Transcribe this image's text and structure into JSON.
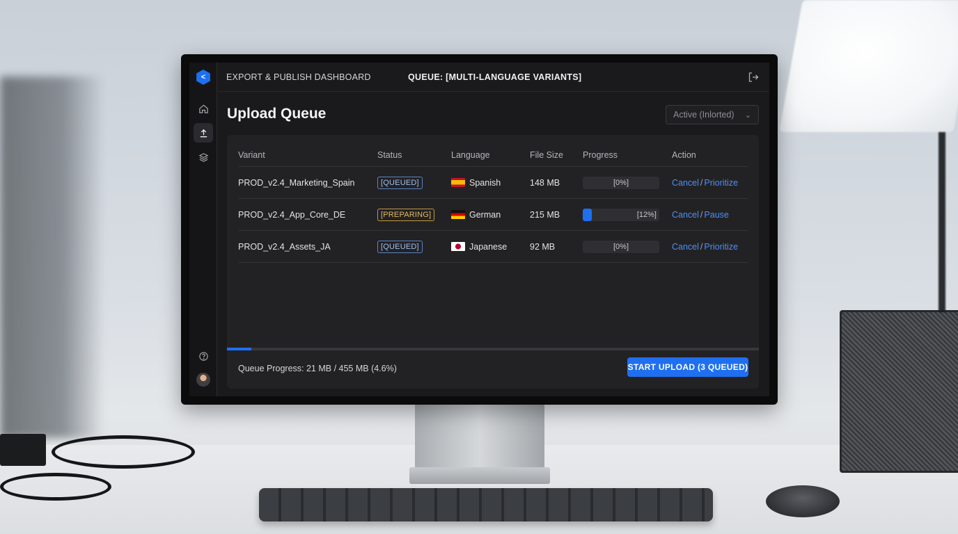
{
  "app": {
    "title": "EXPORT & PUBLISH DASHBOARD",
    "queue_title": "QUEUE: [MULTI-LANGUAGE VARIANTS]",
    "accent_color": "#1f6ff0"
  },
  "sidebar": {
    "items": [
      {
        "icon": "home-icon",
        "active": false
      },
      {
        "icon": "upload-icon",
        "active": true
      },
      {
        "icon": "layers-icon",
        "active": false
      }
    ],
    "bottom": [
      {
        "icon": "help-icon"
      },
      {
        "icon": "avatar"
      }
    ]
  },
  "header": {
    "logout_icon": "logout-icon"
  },
  "main": {
    "title": "Upload Queue",
    "filter": {
      "selected": "Active (Inlorted)"
    }
  },
  "table": {
    "columns": [
      "Variant",
      "Status",
      "Language",
      "File Size",
      "Progress",
      "Action"
    ],
    "rows": [
      {
        "variant": "PROD_v2.4_Marketing_Spain",
        "status": "[QUEUED]",
        "status_color": "#9ec0ee",
        "language": "Spanish",
        "flag_icon": "spain-flag-icon",
        "file_size": "148 MB",
        "progress_label": "[0%]",
        "progress": 0,
        "action_primary": "Cancel",
        "action_secondary": "Prioritize"
      },
      {
        "variant": "PROD_v2.4_App_Core_DE",
        "status": "[PREPARING]",
        "status_color": "#e8b95a",
        "language": "German",
        "flag_icon": "germany-flag-icon",
        "file_size": "215 MB",
        "progress_label": "[12%]",
        "progress": 0.12,
        "action_primary": "Cancel",
        "action_secondary": "Pause"
      },
      {
        "variant": "PROD_v2.4_Assets_JA",
        "status": "[QUEUED]",
        "status_color": "#9ec0ee",
        "language": "Japanese",
        "flag_icon": "japan-flag-icon",
        "file_size": "92 MB",
        "progress_label": "[0%]",
        "progress": 0,
        "action_primary": "Cancel",
        "action_secondary": "Prioritize"
      }
    ],
    "action_separator": "/"
  },
  "footer": {
    "queue_progress_text": "Queue Progress: 21 MB / 455 MB (4.6%)",
    "queue_progress": 0.046,
    "start_button": "START UPLOAD (3 QUEUED)"
  }
}
